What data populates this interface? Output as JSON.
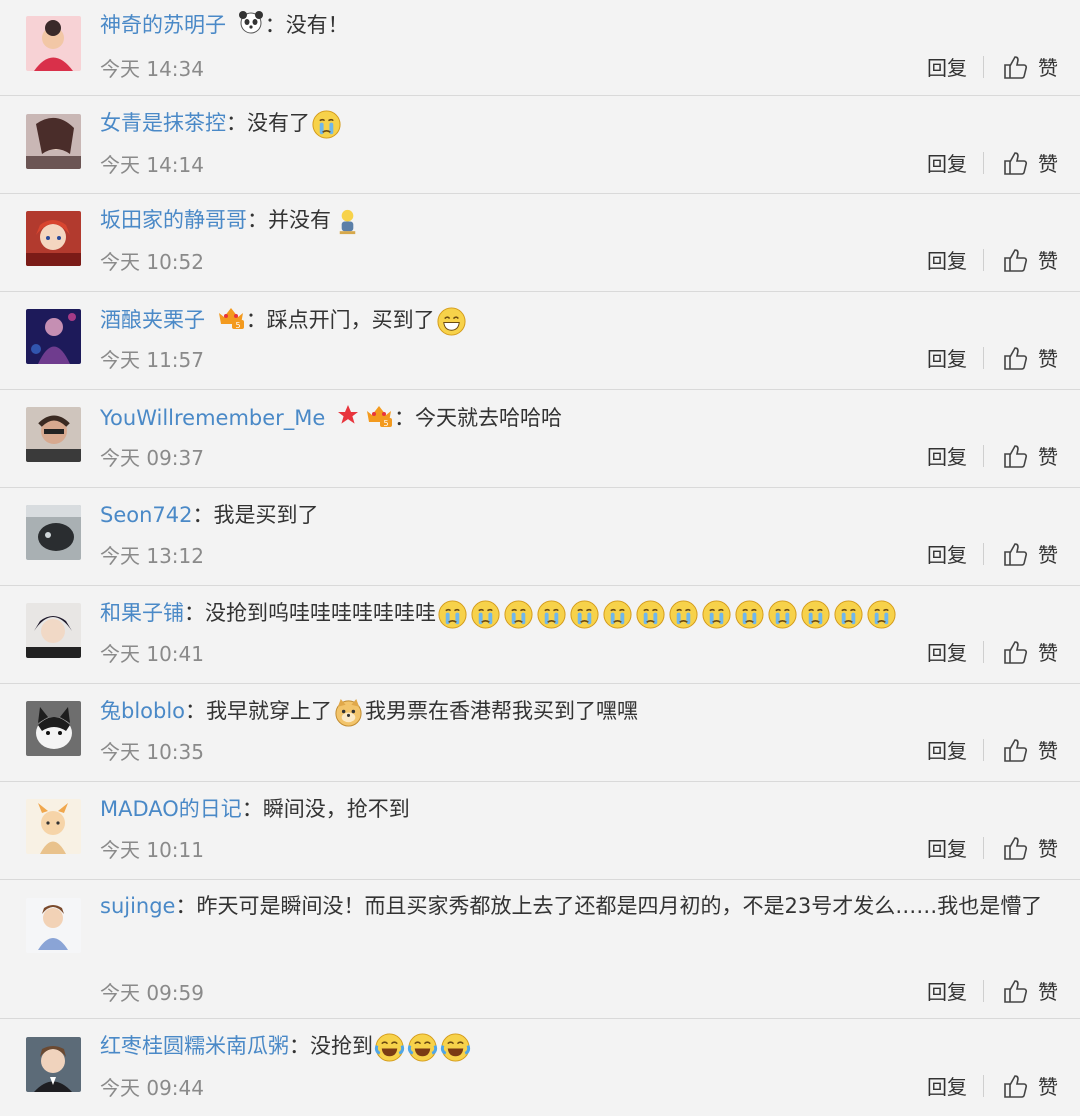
{
  "actions": {
    "reply_label": "回复",
    "like_label": "赞"
  },
  "comments": [
    {
      "username": "神奇的苏明子",
      "text": "没有！",
      "time": "今天 14:34",
      "badges": [
        "panda-icon"
      ],
      "emojis_after": []
    },
    {
      "username": "女青是抹茶控",
      "text": "没有了",
      "time": "今天 14:14",
      "badges": [],
      "emojis_after": [
        "crying-emoji"
      ]
    },
    {
      "username": "坂田家的静哥哥",
      "text": "并没有",
      "time": "今天 10:52",
      "badges": [],
      "emojis_after": [
        "sitting-figure-emoji"
      ]
    },
    {
      "username": "酒酿夹栗子",
      "text": "踩点开门，买到了",
      "time": "今天 11:57",
      "badges": [
        "vip-crown-badge"
      ],
      "emojis_after": [
        "grinning-emoji"
      ]
    },
    {
      "username": "YouWillremember_Me",
      "text": "今天就去哈哈哈",
      "time": "今天 09:37",
      "badges": [
        "red-star-icon",
        "vip-crown-badge"
      ],
      "emojis_after": []
    },
    {
      "username": "Seon742",
      "text": "我是买到了",
      "time": "今天 13:12",
      "badges": [],
      "emojis_after": []
    },
    {
      "username": "和果子铺",
      "text": "没抢到呜哇哇哇哇哇哇哇",
      "time": "今天 10:41",
      "badges": [],
      "emojis_after": [
        "crying-emoji",
        "crying-emoji",
        "crying-emoji",
        "crying-emoji",
        "crying-emoji",
        "crying-emoji",
        "crying-emoji",
        "crying-emoji",
        "crying-emoji",
        "crying-emoji",
        "crying-emoji",
        "crying-emoji",
        "crying-emoji",
        "crying-emoji"
      ]
    },
    {
      "username": "兔bloblo",
      "text": "我早就穿上了",
      "text2": "我男票在香港帮我买到了嘿嘿",
      "time": "今天 10:35",
      "badges": [],
      "emojis_after": [
        "doge-emoji"
      ]
    },
    {
      "username": "MADAO的日记",
      "text": "瞬间没，抢不到",
      "time": "今天 10:11",
      "badges": [],
      "emojis_after": []
    },
    {
      "username": "sujinge",
      "text": "昨天可是瞬间没！而且买家秀都放上去了还都是四月初的，不是23号才发么……我也是懵了",
      "time": "今天 09:59",
      "badges": [],
      "emojis_after": []
    },
    {
      "username": "红枣桂圆糯米南瓜粥",
      "text": "没抢到",
      "time": "今天 09:44",
      "badges": [],
      "emojis_after": [
        "laugh-cry-emoji",
        "laugh-cry-emoji",
        "laugh-cry-emoji"
      ]
    }
  ],
  "colors": {
    "username": "#4a89c7",
    "text": "#333333",
    "time": "#8a8a8a",
    "background": "#f3f3f3",
    "divider": "#d9d9d9"
  }
}
